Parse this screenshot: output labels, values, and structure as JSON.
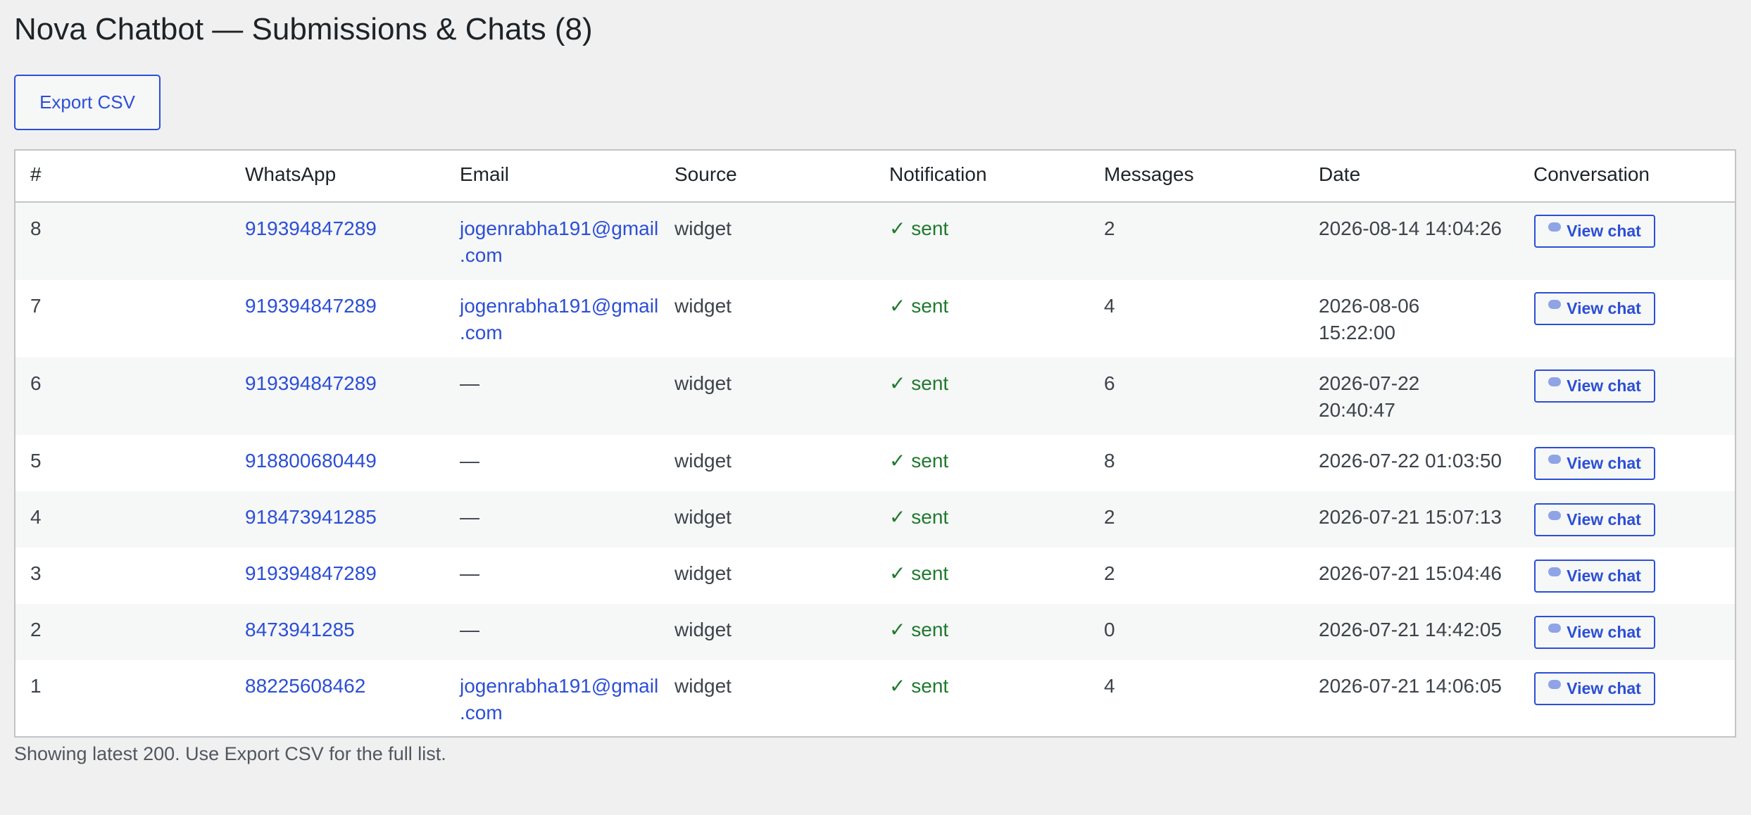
{
  "page": {
    "title": "Nova Chatbot — Submissions & Chats (8)",
    "export_label": "Export CSV",
    "footer_note": "Showing latest 200. Use Export CSV for the full list."
  },
  "table": {
    "headers": [
      "#",
      "WhatsApp",
      "Email",
      "Source",
      "Notification",
      "Messages",
      "Date",
      "Conversation"
    ],
    "rows": [
      {
        "id": "8",
        "whatsapp": "919394847289",
        "email_l1": "jogenrabha191@gmail",
        "email_l2": ".com",
        "source": "widget",
        "notification": "✓ sent",
        "messages": "2",
        "date_l1": "2026-08-14 14:04:26",
        "date_l2": "",
        "action": "View chat"
      },
      {
        "id": "7",
        "whatsapp": "919394847289",
        "email_l1": "jogenrabha191@gmail",
        "email_l2": ".com",
        "source": "widget",
        "notification": "✓ sent",
        "messages": "4",
        "date_l1": "2026-08-06",
        "date_l2": "15:22:00",
        "action": "View chat"
      },
      {
        "id": "6",
        "whatsapp": "919394847289",
        "email_l1": "—",
        "email_l2": "",
        "source": "widget",
        "notification": "✓ sent",
        "messages": "6",
        "date_l1": "2026-07-22",
        "date_l2": "20:40:47",
        "action": "View chat"
      },
      {
        "id": "5",
        "whatsapp": "918800680449",
        "email_l1": "—",
        "email_l2": "",
        "source": "widget",
        "notification": "✓ sent",
        "messages": "8",
        "date_l1": "2026-07-22 01:03:50",
        "date_l2": "",
        "action": "View chat"
      },
      {
        "id": "4",
        "whatsapp": "918473941285",
        "email_l1": "—",
        "email_l2": "",
        "source": "widget",
        "notification": "✓ sent",
        "messages": "2",
        "date_l1": "2026-07-21 15:07:13",
        "date_l2": "",
        "action": "View chat"
      },
      {
        "id": "3",
        "whatsapp": "919394847289",
        "email_l1": "—",
        "email_l2": "",
        "source": "widget",
        "notification": "✓ sent",
        "messages": "2",
        "date_l1": "2026-07-21 15:04:46",
        "date_l2": "",
        "action": "View chat"
      },
      {
        "id": "2",
        "whatsapp": "8473941285",
        "email_l1": "—",
        "email_l2": "",
        "source": "widget",
        "notification": "✓ sent",
        "messages": "0",
        "date_l1": "2026-07-21 14:42:05",
        "date_l2": "",
        "action": "View chat"
      },
      {
        "id": "1",
        "whatsapp": "88225608462",
        "email_l1": "jogenrabha191@gmail",
        "email_l2": ".com",
        "source": "widget",
        "notification": "✓ sent",
        "messages": "4",
        "date_l1": "2026-07-21 14:06:05",
        "date_l2": "",
        "action": "View chat"
      }
    ]
  },
  "icons": {
    "chat": "speech-bubble-icon"
  },
  "colors": {
    "link": "#2c4fd6",
    "sent": "#1f7a2e",
    "background": "#f0f0f1"
  }
}
